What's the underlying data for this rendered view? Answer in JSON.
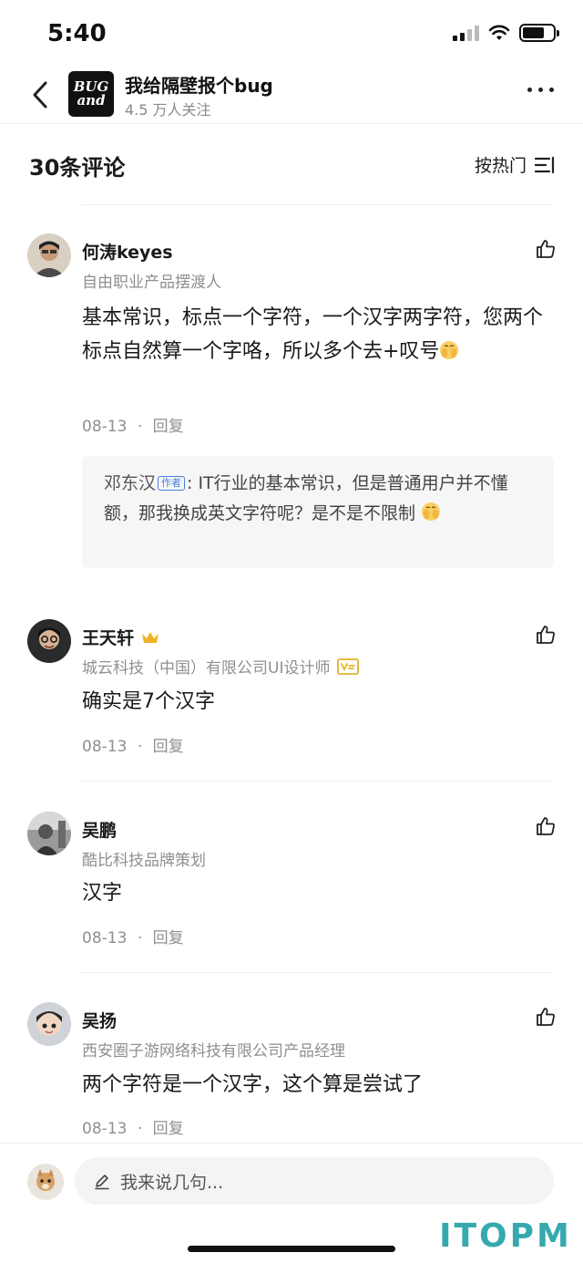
{
  "status_bar": {
    "time": "5:40"
  },
  "header": {
    "logo_text_top": "BUG",
    "logo_text_bottom": "and",
    "title": "我给隔壁报个bug",
    "subtitle": "4.5 万人关注"
  },
  "comments_header": {
    "count_label": "30条评论",
    "sort_label": "按热门"
  },
  "comments": [
    {
      "name": "何涛keyes",
      "title": "自由职业产品摆渡人",
      "text": "基本常识，标点一个字符，一个汉字两字符，您两个标点自然算一个字咯，所以多个去+叹号",
      "date": "08-13",
      "reply_label": "回复",
      "reply": {
        "author": "邓东汉",
        "badge": "作者",
        "text": ": IT行业的基本常识，但是普通用户并不懂额，那我换成英文字符呢？是不是不限制"
      }
    },
    {
      "name": "王天轩",
      "title": "城云科技（中国）有限公司UI设计师",
      "text": "确实是7个汉字",
      "date": "08-13",
      "reply_label": "回复"
    },
    {
      "name": "吴鹏",
      "title": "酷比科技品牌策划",
      "text": "汉字",
      "date": "08-13",
      "reply_label": "回复"
    },
    {
      "name": "吴扬",
      "title": "西安圈子游网络科技有限公司产品经理",
      "text": "两个字符是一个汉字，这个算是尝试了",
      "date": "08-13",
      "reply_label": "回复"
    }
  ],
  "meta_separator": "·",
  "input": {
    "placeholder": "我来说几句..."
  },
  "watermark": "ITOPM",
  "icons": {
    "back": "chevron-left-icon",
    "more": "more-dots-icon",
    "sort": "sort-lines-icon",
    "like": "thumbs-up-icon",
    "edit": "pencil-icon",
    "crown": "crown-icon",
    "verified": "v-badge-icon",
    "emoji": "smile-emoji-icon"
  },
  "colors": {
    "accent_blue": "#4a7fd8",
    "crown_gold": "#f0b429",
    "badge_yellow": "#e0b52a",
    "watermark_teal": "#35a9ae"
  }
}
